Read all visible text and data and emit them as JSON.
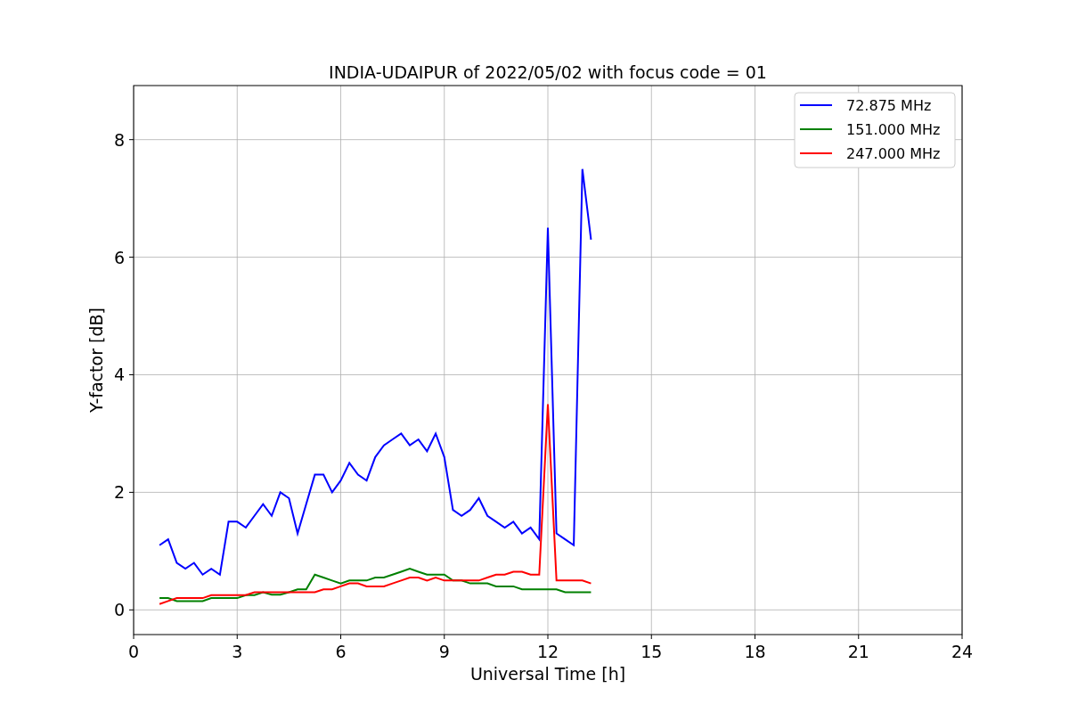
{
  "chart_data": {
    "type": "line",
    "title": "INDIA-UDAIPUR of 2022/05/02 with focus code = 01",
    "xlabel": "Universal Time [h]",
    "ylabel": "Y-factor [dB]",
    "x": [
      0.75,
      1.0,
      1.25,
      1.5,
      1.75,
      2.0,
      2.25,
      2.5,
      2.75,
      3.0,
      3.25,
      3.5,
      3.75,
      4.0,
      4.25,
      4.5,
      4.75,
      5.0,
      5.25,
      5.5,
      5.75,
      6.0,
      6.25,
      6.5,
      6.75,
      7.0,
      7.25,
      7.5,
      7.75,
      8.0,
      8.25,
      8.5,
      8.75,
      9.0,
      9.25,
      9.5,
      9.75,
      10.0,
      10.25,
      10.5,
      10.75,
      11.0,
      11.25,
      11.5,
      11.75,
      12.0,
      12.25,
      12.5,
      12.75,
      13.0,
      13.25
    ],
    "series": [
      {
        "name": "72.875 MHz",
        "color": "#0000ff",
        "values": [
          1.1,
          1.2,
          0.8,
          0.7,
          0.8,
          0.6,
          0.7,
          0.6,
          1.5,
          1.5,
          1.4,
          1.6,
          1.8,
          1.6,
          2.0,
          1.9,
          1.3,
          1.8,
          2.3,
          2.3,
          2.0,
          2.2,
          2.5,
          2.3,
          2.2,
          2.6,
          2.8,
          2.9,
          3.0,
          2.8,
          2.9,
          2.7,
          3.0,
          2.6,
          1.7,
          1.6,
          1.7,
          1.9,
          1.6,
          1.5,
          1.4,
          1.5,
          1.3,
          1.4,
          1.2,
          6.5,
          1.3,
          1.2,
          1.1,
          7.5,
          6.3
        ]
      },
      {
        "name": "151.000 MHz",
        "color": "#008000",
        "values": [
          0.2,
          0.2,
          0.15,
          0.15,
          0.15,
          0.15,
          0.2,
          0.2,
          0.2,
          0.2,
          0.25,
          0.25,
          0.3,
          0.26,
          0.26,
          0.3,
          0.35,
          0.35,
          0.6,
          0.55,
          0.5,
          0.45,
          0.5,
          0.5,
          0.5,
          0.55,
          0.55,
          0.6,
          0.65,
          0.7,
          0.65,
          0.6,
          0.6,
          0.6,
          0.5,
          0.5,
          0.45,
          0.45,
          0.45,
          0.4,
          0.4,
          0.4,
          0.35,
          0.35,
          0.35,
          0.35,
          0.35,
          0.3,
          0.3,
          0.3,
          0.3
        ]
      },
      {
        "name": "247.000 MHz",
        "color": "#ff0000",
        "values": [
          0.1,
          0.15,
          0.2,
          0.2,
          0.2,
          0.2,
          0.25,
          0.25,
          0.25,
          0.25,
          0.25,
          0.3,
          0.3,
          0.3,
          0.3,
          0.3,
          0.3,
          0.3,
          0.3,
          0.35,
          0.35,
          0.4,
          0.45,
          0.45,
          0.4,
          0.4,
          0.4,
          0.45,
          0.5,
          0.55,
          0.55,
          0.5,
          0.55,
          0.5,
          0.5,
          0.5,
          0.5,
          0.5,
          0.55,
          0.6,
          0.6,
          0.65,
          0.65,
          0.6,
          0.6,
          3.5,
          0.5,
          0.5,
          0.5,
          0.5,
          0.45
        ]
      }
    ],
    "grid": true,
    "legend": "upper right",
    "xlim": [
      0,
      24
    ],
    "ylim": [
      -0.42,
      8.92
    ],
    "xticks": [
      0,
      3,
      6,
      9,
      12,
      15,
      18,
      21,
      24
    ],
    "yticks": [
      0,
      2,
      4,
      6,
      8
    ]
  }
}
